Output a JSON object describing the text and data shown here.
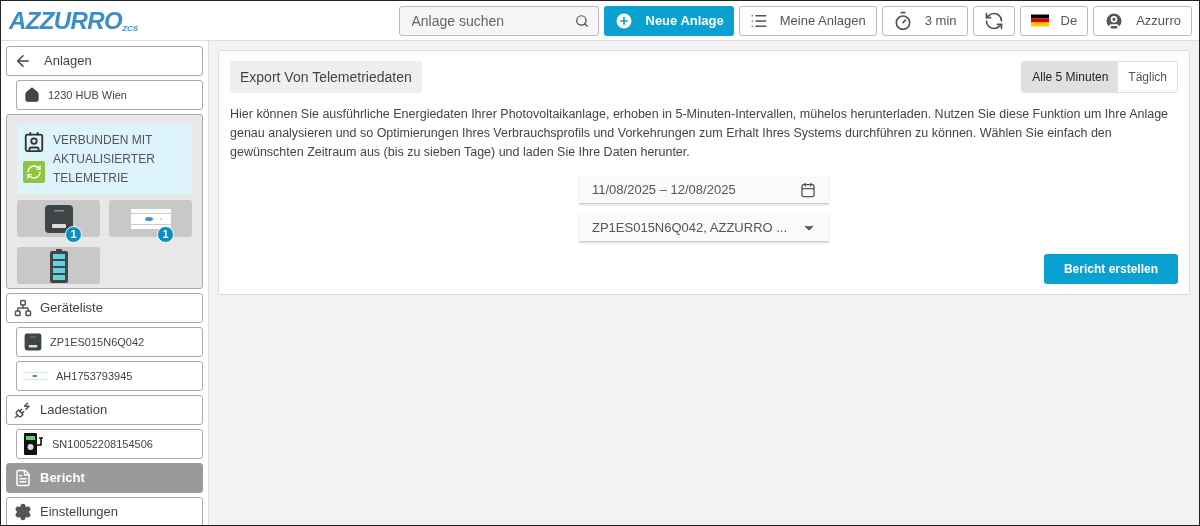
{
  "logo": {
    "name": "AZZURRO",
    "sub": "ZCS"
  },
  "header": {
    "search": {
      "placeholder": "Anlage suchen"
    },
    "buttons": [
      {
        "kind": "new",
        "label": "Neue Anlage"
      },
      {
        "kind": "list",
        "label": "Meine Anlagen"
      },
      {
        "kind": "timer",
        "label": "3 min"
      },
      {
        "kind": "refresh"
      },
      {
        "kind": "language",
        "label": "De"
      },
      {
        "kind": "user",
        "label": "Azzurro"
      }
    ]
  },
  "sidebar": {
    "back": {
      "label": "Anlagen"
    },
    "plant": {
      "label": "1230 HUB Wien"
    },
    "status": {
      "text": "VERBUNDEN MIT AKTUALISIERTER TELEMETRIE",
      "devices": [
        {
          "kind": "inverter",
          "count": "1"
        },
        {
          "kind": "meter",
          "count": "1"
        },
        {
          "kind": "battery"
        }
      ]
    },
    "items": [
      {
        "kind": "devices",
        "label": "Geräteliste",
        "selected": false,
        "children": [
          {
            "kind": "inverter",
            "label": "ZP1ES015N6Q042",
            "selected": false
          },
          {
            "kind": "meter",
            "label": "AH1753793945",
            "selected": false
          }
        ]
      },
      {
        "kind": "charger",
        "label": "Ladestation",
        "selected": false,
        "children": [
          {
            "kind": "wallbox",
            "label": "SN10052208154506",
            "selected": false
          }
        ]
      },
      {
        "kind": "report",
        "label": "Bericht",
        "selected": true
      },
      {
        "kind": "settings",
        "label": "Einstellungen",
        "selected": false
      }
    ]
  },
  "export": {
    "title": "Export Von Telemetriedaten",
    "intervals": [
      {
        "label": "Alle 5 Minuten",
        "selected": true
      },
      {
        "label": "Täglich",
        "selected": false
      }
    ],
    "description": "Hier können Sie ausführliche Energiedaten Ihrer Photovoltaikanlage, erhoben in 5-Minuten-Intervallen, mühelos herunterladen. Nutzen Sie diese Funktion um Ihre Anlage genau analysieren und so Optimierungen Ihres Verbrauchsprofils und Vorkehrungen zum Erhalt Ihres Systems durchführen zu können. Wählen Sie einfach den gewünschten Zeitraum aus (bis zu sieben Tage) und laden Sie Ihre Daten herunter.",
    "date_range": "11/08/2025 – 12/08/2025",
    "device": "ZP1ES015N6Q042, AZZURRO ...",
    "button": "Bericht erstellen"
  }
}
